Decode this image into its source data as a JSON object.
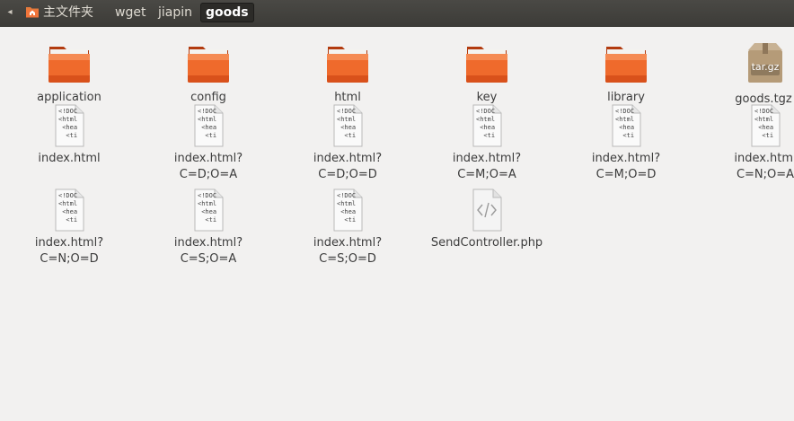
{
  "breadcrumbs": [
    {
      "label": "主文件夹",
      "icon": "home-folder-icon"
    },
    {
      "label": "wget"
    },
    {
      "label": "jiapin"
    },
    {
      "label": "goods",
      "active": true
    }
  ],
  "files": [
    {
      "name": "application",
      "type": "folder"
    },
    {
      "name": "config",
      "type": "folder"
    },
    {
      "name": "html",
      "type": "folder"
    },
    {
      "name": "key",
      "type": "folder"
    },
    {
      "name": "library",
      "type": "folder"
    },
    {
      "name": "goods.tgz",
      "type": "archive",
      "badge": "tar.gz"
    },
    {
      "name": "index.html",
      "type": "html"
    },
    {
      "name": "index.html?",
      "name2": "C=D;O=A",
      "type": "html"
    },
    {
      "name": "index.html?",
      "name2": "C=D;O=D",
      "type": "html"
    },
    {
      "name": "index.html?",
      "name2": "C=M;O=A",
      "type": "html"
    },
    {
      "name": "index.html?",
      "name2": "C=M;O=D",
      "type": "html"
    },
    {
      "name": "index.html",
      "name2": "C=N;O=A",
      "type": "html"
    },
    {
      "name": "index.html?",
      "name2": "C=N;O=D",
      "type": "html"
    },
    {
      "name": "index.html?",
      "name2": "C=S;O=A",
      "type": "html"
    },
    {
      "name": "index.html?",
      "name2": "C=S;O=D",
      "type": "html"
    },
    {
      "name": "SendController.php",
      "type": "php"
    }
  ],
  "html_icon_text": [
    "<!DOC",
    "<html",
    "<hea",
    "<ti"
  ],
  "colors": {
    "folder": "#e95420",
    "pathbar": "#3c3b37",
    "background": "#f2f1f0"
  }
}
